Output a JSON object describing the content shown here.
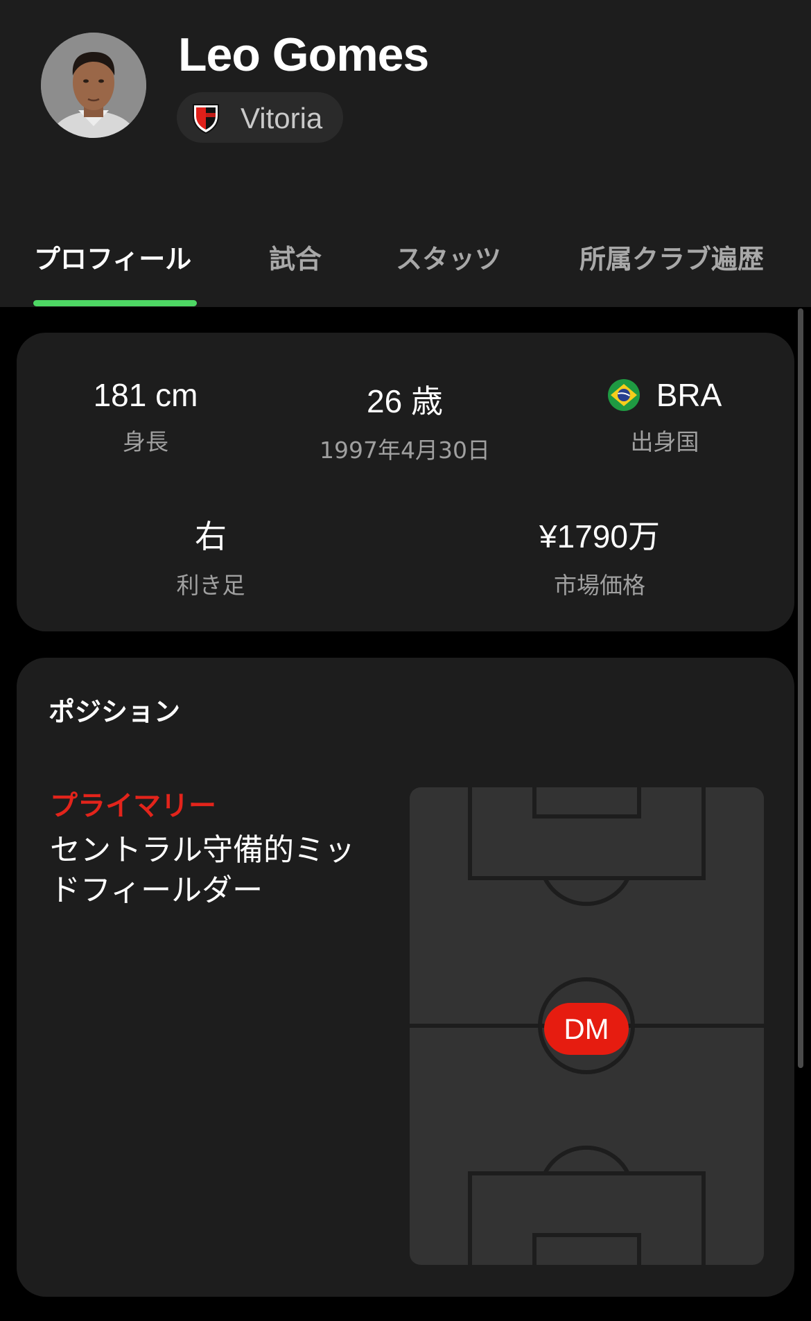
{
  "player": {
    "name": "Leo Gomes",
    "club": "Vitoria"
  },
  "tabs": [
    {
      "label": "プロフィール",
      "active": true
    },
    {
      "label": "試合",
      "active": false
    },
    {
      "label": "スタッツ",
      "active": false
    },
    {
      "label": "所属クラブ遍歴",
      "active": false
    }
  ],
  "stats": {
    "height": {
      "value": "181 cm",
      "label": "身長"
    },
    "age": {
      "value": "26 歳",
      "label": "1997年4月30日"
    },
    "country": {
      "value": "BRA",
      "label": "出身国",
      "flag_icon": "brazil-flag-icon"
    },
    "foot": {
      "value": "右",
      "label": "利き足"
    },
    "market_value": {
      "value": "¥1790万",
      "label": "市場価格"
    }
  },
  "position": {
    "title": "ポジション",
    "primary_label": "プライマリー",
    "primary_name": "セントラル守備的ミッドフィールダー",
    "badge": "DM"
  },
  "colors": {
    "background": "#000000",
    "card": "#1d1d1d",
    "tab_indicator": "#4ed764",
    "primary_red": "#e3241b",
    "badge_red": "#e61c10",
    "pitch": "#333333"
  }
}
